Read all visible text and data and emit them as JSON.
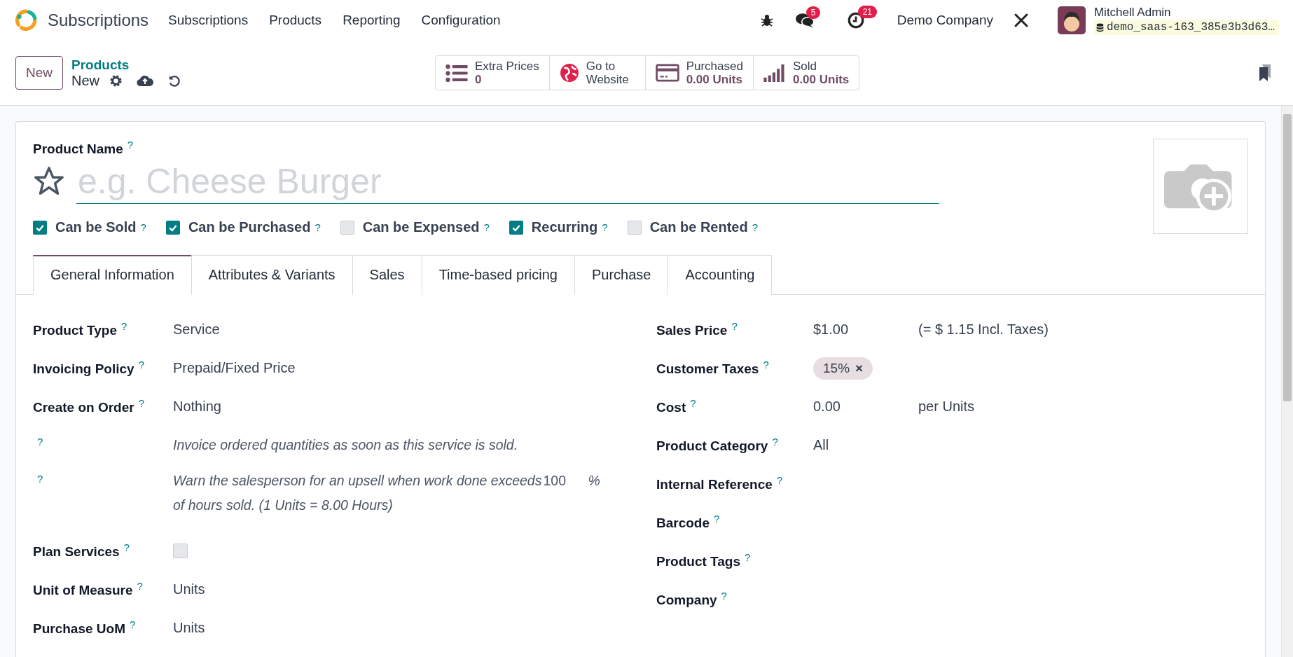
{
  "app": {
    "name": "Subscriptions"
  },
  "menu": [
    "Subscriptions",
    "Products",
    "Reporting",
    "Configuration"
  ],
  "systray": {
    "messages_count": "5",
    "activities_count": "21",
    "company": "Demo Company",
    "user": "Mitchell Admin",
    "database": "demo_saas-163_385e3b3d63…"
  },
  "control_panel": {
    "new_button": "New",
    "breadcrumb": "Products",
    "record": "New"
  },
  "smart_buttons": [
    {
      "kind": "list",
      "label": "Extra Prices",
      "value": "0"
    },
    {
      "kind": "globe",
      "label": "Go to Website"
    },
    {
      "kind": "card",
      "label": "Purchased",
      "value": "0.00 Units"
    },
    {
      "kind": "bars",
      "label": "Sold",
      "value": "0.00 Units"
    }
  ],
  "form": {
    "name_label": "Product Name",
    "name_help": "?",
    "name_placeholder": "e.g. Cheese Burger",
    "favorite": false,
    "options": [
      {
        "label": "Can be Sold",
        "help": "?",
        "checked": true
      },
      {
        "label": "Can be Purchased",
        "help": "?",
        "checked": true
      },
      {
        "label": "Can be Expensed",
        "help": "?",
        "checked": false
      },
      {
        "label": "Recurring",
        "help": "?",
        "checked": true
      },
      {
        "label": "Can be Rented",
        "help": "?",
        "checked": false
      }
    ],
    "tabs": [
      {
        "label": "General Information",
        "selected": true
      },
      {
        "label": "Attributes & Variants",
        "selected": false
      },
      {
        "label": "Sales",
        "selected": false
      },
      {
        "label": "Time-based pricing",
        "selected": false
      },
      {
        "label": "Purchase",
        "selected": false
      },
      {
        "label": "Accounting",
        "selected": false
      }
    ],
    "left_fields": [
      {
        "kind": "text",
        "label": "Product Type",
        "help": "?",
        "value": "Service"
      },
      {
        "kind": "text",
        "label": "Invoicing Policy",
        "help": "?",
        "value": "Prepaid/Fixed Price"
      },
      {
        "kind": "text",
        "label": "Create on Order",
        "help": "?",
        "value": "Nothing"
      },
      {
        "kind": "note",
        "help": "?",
        "text": "Invoice ordered quantities as soon as this service is sold."
      },
      {
        "kind": "upsell",
        "help": "?",
        "text": "Warn the salesperson for an upsell when work done exceeds",
        "value": "100",
        "unit": "%",
        "text2": "of hours sold. (1 Units = 8.00 Hours)"
      },
      {
        "kind": "checkbox",
        "label": "Plan Services",
        "help": "?",
        "checked": false
      },
      {
        "kind": "text",
        "label": "Unit of Measure",
        "help": "?",
        "value": "Units"
      },
      {
        "kind": "text",
        "label": "Purchase UoM",
        "help": "?",
        "value": "Units"
      }
    ],
    "right_fields": [
      {
        "kind": "text",
        "label": "Sales Price",
        "help": "?",
        "value": "$1.00",
        "extra": "(= $ 1.15 Incl. Taxes)"
      },
      {
        "kind": "tags",
        "label": "Customer Taxes",
        "help": "?",
        "tags": [
          {
            "label": "15%",
            "remove": "×"
          }
        ]
      },
      {
        "kind": "text",
        "label": "Cost",
        "help": "?",
        "value": "0.00",
        "extra": "per Units"
      },
      {
        "kind": "text",
        "label": "Product Category",
        "help": "?",
        "value": "All"
      },
      {
        "kind": "text",
        "label": "Internal Reference",
        "help": "?"
      },
      {
        "kind": "text",
        "label": "Barcode",
        "help": "?"
      },
      {
        "kind": "text",
        "label": "Product Tags",
        "help": "?"
      },
      {
        "kind": "text",
        "label": "Company",
        "help": "?"
      }
    ]
  }
}
